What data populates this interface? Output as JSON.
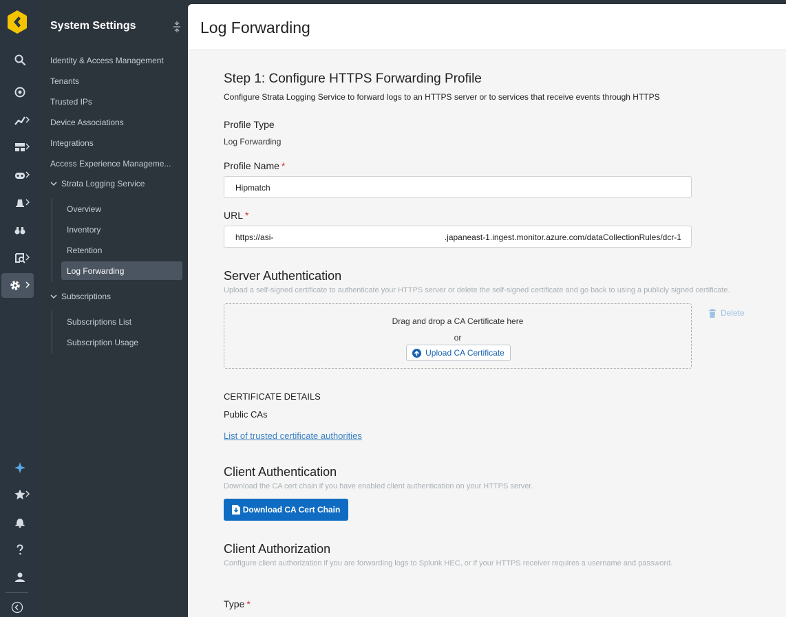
{
  "app": {
    "sidebar_title": "System Settings"
  },
  "nav": {
    "items": [
      "Identity & Access Management",
      "Tenants",
      "Trusted IPs",
      "Device Associations",
      "Integrations",
      "Access Experience Manageme..."
    ],
    "strata_group": {
      "label": "Strata Logging Service",
      "children": [
        "Overview",
        "Inventory",
        "Retention",
        "Log Forwarding"
      ]
    },
    "subscriptions_group": {
      "label": "Subscriptions",
      "children": [
        "Subscriptions List",
        "Subscription Usage"
      ]
    }
  },
  "page": {
    "title": "Log Forwarding",
    "step_title": "Step 1: Configure HTTPS Forwarding Profile",
    "step_desc": "Configure Strata Logging Service to forward logs to an HTTPS server or to services that receive events through HTTPS",
    "profile_type_label": "Profile Type",
    "profile_type_value": "Log Forwarding",
    "profile_name_label": "Profile Name",
    "profile_name_value": "Hipmatch",
    "url_label": "URL",
    "url_value_start": "https://asi-",
    "url_value_end": ".japaneast-1.ingest.monitor.azure.com/dataCollectionRules/dcr-1",
    "required_mark": "*",
    "server_auth": {
      "title": "Server Authentication",
      "desc": "Upload a self-signed certificate to authenticate your HTTPS server or delete the self-signed certificate and go back to using a publicly signed certificate.",
      "drop_text": "Drag and drop a CA Certificate here",
      "or_text": "or",
      "upload_label": "Upload CA Certificate",
      "delete_label": "Delete"
    },
    "cert_details": {
      "heading": "CERTIFICATE DETAILS",
      "value": "Public CAs",
      "link": "List of trusted certificate authorities"
    },
    "client_auth": {
      "title": "Client Authentication",
      "desc": "Download the CA cert chain if you have enabled client authentication on your HTTPS server.",
      "download_label": "Download CA Cert Chain"
    },
    "client_authz": {
      "title": "Client Authorization",
      "desc": "Configure client authorization if you are forwarding logs to Splunk HEC, or if your HTTPS receiver requires a username and password.",
      "type_label": "Type"
    }
  },
  "colors": {
    "accent": "#0f6cc2",
    "logo": "#f5c400",
    "required": "#d0323c",
    "link": "#3b82c4"
  }
}
